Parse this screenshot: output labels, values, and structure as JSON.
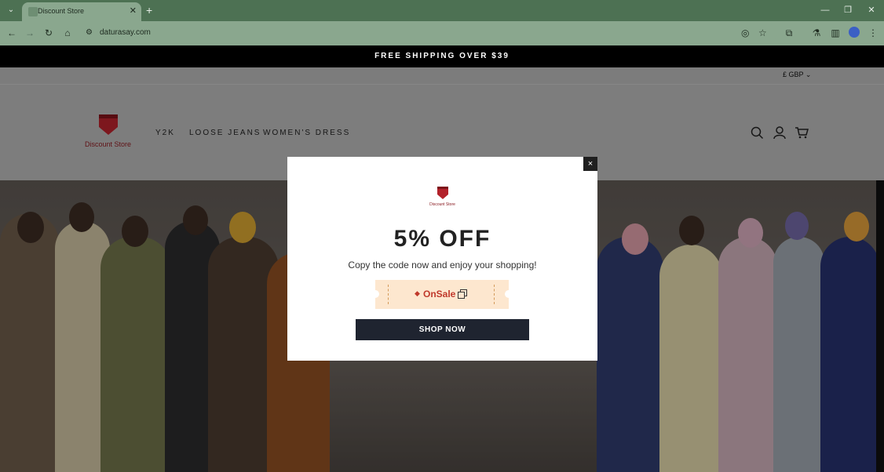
{
  "browser": {
    "tab_title": "Discount Store",
    "url": "daturasay.com",
    "icons": [
      "tab-list-icon",
      "close-icon",
      "plus-icon",
      "minimize-icon",
      "restore-icon",
      "close-window-icon",
      "back-icon",
      "forward-icon",
      "reload-icon",
      "home-icon",
      "site-info-icon",
      "eye-off-icon",
      "star-icon",
      "extensions-icon",
      "lab-icon",
      "sidepanel-icon",
      "profile-icon",
      "menu-icon"
    ]
  },
  "promo": {
    "text": "FREE SHIPPING OVER $39"
  },
  "currency": {
    "label": "£ GBP"
  },
  "header": {
    "logo_text": "Discount Store",
    "nav": [
      "Y2K",
      "LOOSE JEANS",
      "WOMEN'S DRESS"
    ],
    "icons": [
      "search-icon",
      "account-icon",
      "cart-icon"
    ]
  },
  "modal": {
    "logo_text": "Discount Store",
    "title": "5% OFF",
    "subtitle": "Copy the code now and enjoy your shopping!",
    "coupon_code": "OnSale",
    "button_label": "SHOP NOW",
    "close_label": "×"
  },
  "colors": {
    "brand_red": "#b3222b",
    "button_dark": "#1f2430",
    "coupon_bg": "#fde7cf",
    "browser_green": "#4d7153"
  }
}
